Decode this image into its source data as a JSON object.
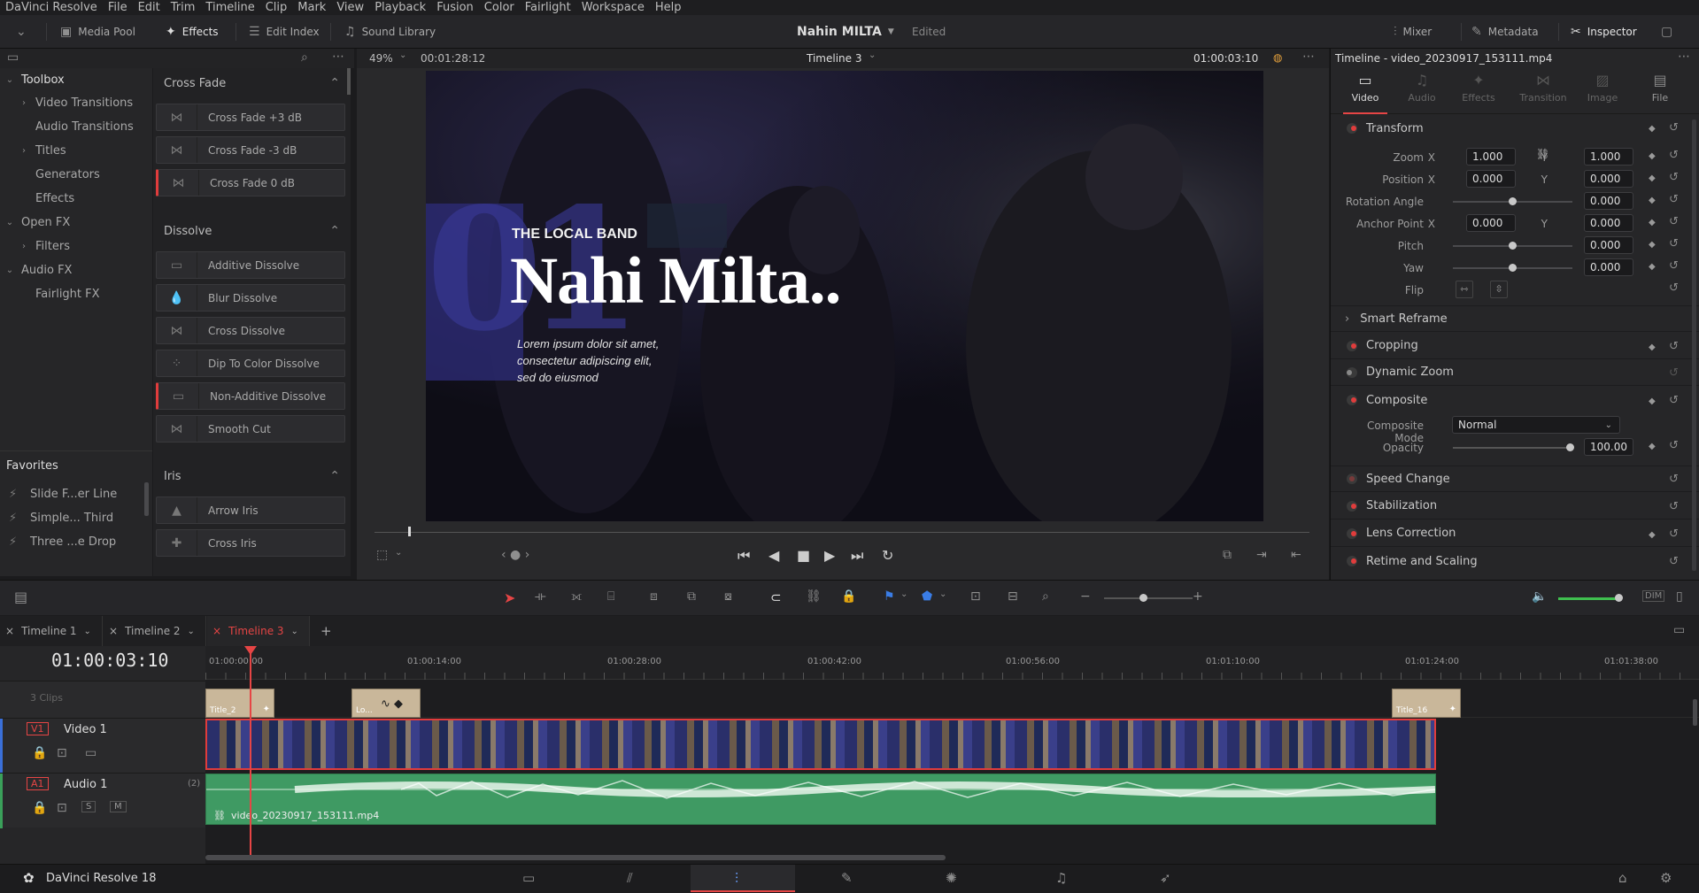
{
  "menu": [
    "DaVinci Resolve",
    "File",
    "Edit",
    "Trim",
    "Timeline",
    "Clip",
    "Mark",
    "View",
    "Playback",
    "Fusion",
    "Color",
    "Fairlight",
    "Workspace",
    "Help"
  ],
  "toolbar": {
    "media_pool": "Media Pool",
    "effects": "Effects",
    "edit_index": "Edit Index",
    "sound_library": "Sound Library",
    "project_title": "Nahin MILTA",
    "edited": "Edited",
    "mixer": "Mixer",
    "metadata": "Metadata",
    "inspector": "Inspector"
  },
  "toolbox": {
    "title": "Toolbox",
    "items": [
      "Video Transitions",
      "Audio Transitions",
      "Titles",
      "Generators",
      "Effects",
      "Open FX",
      "Filters",
      "Audio FX",
      "Fairlight FX"
    ]
  },
  "favorites": {
    "title": "Favorites",
    "items": [
      "Slide F...er Line",
      "Simple... Third",
      "Three ...e Drop"
    ]
  },
  "effects": {
    "cross_fade": {
      "title": "Cross Fade",
      "items": [
        "Cross Fade +3 dB",
        "Cross Fade -3 dB",
        "Cross Fade 0 dB"
      ]
    },
    "dissolve": {
      "title": "Dissolve",
      "items": [
        "Additive Dissolve",
        "Blur Dissolve",
        "Cross Dissolve",
        "Dip To Color Dissolve",
        "Non-Additive Dissolve",
        "Smooth Cut"
      ]
    },
    "iris": {
      "title": "Iris",
      "items": [
        "Arrow Iris",
        "Cross Iris"
      ]
    }
  },
  "viewer": {
    "zoom": "49%",
    "duration": "00:01:28:12",
    "timeline": "Timeline 3",
    "timecode": "01:00:03:10"
  },
  "overlay": {
    "big_number": "01",
    "band": "THE LOCAL BAND",
    "title": "Nahi Milta..",
    "body": "Lorem ipsum dolor sit amet,\nconsectetur adipiscing elit,\nsed do eiusmod"
  },
  "inspector": {
    "header": "Timeline - video_20230917_153111.mp4",
    "tabs": [
      "Video",
      "Audio",
      "Effects",
      "Transition",
      "Image",
      "File"
    ],
    "transform": "Transform",
    "zoom_label": "Zoom",
    "zoom_x": "1.000",
    "zoom_y": "1.000",
    "position_label": "Position",
    "pos_x": "0.000",
    "pos_y": "0.000",
    "rotation_label": "Rotation Angle",
    "rotation": "0.000",
    "anchor_label": "Anchor Point",
    "anchor_x": "0.000",
    "anchor_y": "0.000",
    "pitch_label": "Pitch",
    "pitch": "0.000",
    "yaw_label": "Yaw",
    "yaw": "0.000",
    "flip_label": "Flip",
    "x": "X",
    "y": "Y",
    "smart_reframe": "Smart Reframe",
    "cropping": "Cropping",
    "dynamic_zoom": "Dynamic Zoom",
    "composite": "Composite",
    "composite_mode_label": "Composite Mode",
    "composite_mode": "Normal",
    "opacity_label": "Opacity",
    "opacity": "100.00",
    "speed_change": "Speed Change",
    "stabilization": "Stabilization",
    "lens_correction": "Lens Correction",
    "retime": "Retime and Scaling"
  },
  "timeline": {
    "tabs": [
      "Timeline 1",
      "Timeline 2",
      "Timeline 3"
    ],
    "timecode": "01:00:03:10",
    "ruler": [
      "01:00:00:00",
      "01:00:14:00",
      "01:00:28:00",
      "01:00:42:00",
      "01:00:56:00",
      "01:01:10:00",
      "01:01:24:00",
      "01:01:38:00"
    ],
    "clips_count": "3 Clips",
    "v1": "V1",
    "video1": "Video 1",
    "a1": "A1",
    "audio1": "Audio 1",
    "a1_ch": "(2)",
    "title_clip1": "Title_2",
    "title_clip2": "Lo...",
    "title_clip3": "Title_16",
    "audio_clip": "video_20230917_153111.mp4",
    "s": "S",
    "m": "M"
  },
  "status": {
    "app": "DaVinci Resolve 18"
  },
  "colors": {
    "accent_red": "#e64545",
    "audio_green": "#3f9a63",
    "video_border": "#e03c3c",
    "title_clip": "#c9b79a"
  }
}
